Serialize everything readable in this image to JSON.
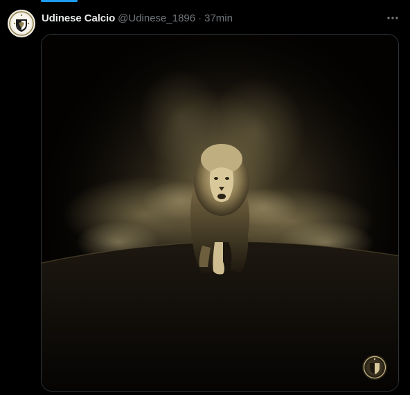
{
  "post": {
    "author_name": "Udinese Calcio",
    "handle": "@Udinese_1896",
    "separator": "·",
    "time": "37min"
  },
  "icons": {
    "avatar": "udinese-crest-icon",
    "more": "more-options-icon",
    "watermark": "udinese-crest-icon"
  },
  "colors": {
    "background": "#000000",
    "name_text": "#e7e9ea",
    "secondary_text": "#71767b",
    "accent": "#1d9bf0",
    "media_tone": "#b8a77a"
  }
}
